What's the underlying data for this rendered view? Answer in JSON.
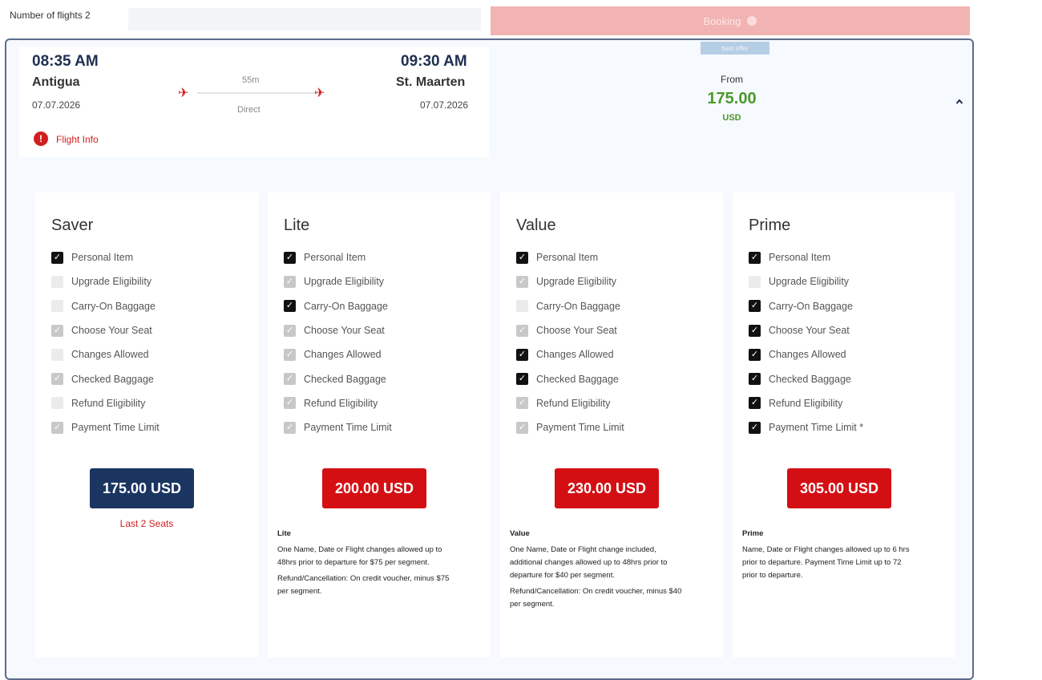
{
  "header": {
    "flights_count": "Number of flights 2",
    "faded_button": "Booking"
  },
  "flight": {
    "badge": "best offer",
    "departure": {
      "time": "08:35 AM",
      "city": "Antigua",
      "date": "07.07.2026"
    },
    "arrival": {
      "time": "09:30 AM",
      "city": "St. Maarten",
      "date": "07.07.2026"
    },
    "duration": "55m",
    "stops": "Direct",
    "info_link": "Flight Info",
    "from_label": "From",
    "from_price": "175.00",
    "from_currency": "USD"
  },
  "fares": [
    {
      "name": "Saver",
      "price": "175.00 USD",
      "button_color": "#1b3561",
      "last_seats": "Last 2 Seats",
      "desc_title": "",
      "desc_lines": [],
      "features": [
        {
          "label": "Personal Item",
          "state": "on"
        },
        {
          "label": "Upgrade Eligibility",
          "state": "off"
        },
        {
          "label": "Carry-On Baggage",
          "state": "off"
        },
        {
          "label": "Choose Your Seat",
          "state": "dim"
        },
        {
          "label": "Changes Allowed",
          "state": "off"
        },
        {
          "label": "Checked Baggage",
          "state": "dim"
        },
        {
          "label": "Refund Eligibility",
          "state": "off"
        },
        {
          "label": "Payment Time Limit",
          "state": "dim"
        }
      ]
    },
    {
      "name": "Lite",
      "price": "200.00 USD",
      "button_color": "#d40f14",
      "last_seats": "",
      "desc_title": "Lite",
      "desc_lines": [
        "One Name, Date or Flight changes allowed up to 48hrs prior to departure for $75 per segment.",
        "Refund/Cancellation: On credit voucher, minus $75 per segment."
      ],
      "features": [
        {
          "label": "Personal Item",
          "state": "on"
        },
        {
          "label": "Upgrade Eligibility",
          "state": "dim"
        },
        {
          "label": "Carry-On Baggage",
          "state": "on"
        },
        {
          "label": "Choose Your Seat",
          "state": "dim"
        },
        {
          "label": "Changes Allowed",
          "state": "dim"
        },
        {
          "label": "Checked Baggage",
          "state": "dim"
        },
        {
          "label": "Refund Eligibility",
          "state": "dim"
        },
        {
          "label": "Payment Time Limit",
          "state": "dim"
        }
      ]
    },
    {
      "name": "Value",
      "price": "230.00 USD",
      "button_color": "#d40f14",
      "last_seats": "",
      "desc_title": "Value",
      "desc_lines": [
        "One Name, Date or Flight change included, additional changes allowed up to 48hrs prior to departure for $40 per segment.",
        "Refund/Cancellation: On credit voucher, minus $40 per segment."
      ],
      "features": [
        {
          "label": "Personal Item",
          "state": "on"
        },
        {
          "label": "Upgrade Eligibility",
          "state": "dim"
        },
        {
          "label": "Carry-On Baggage",
          "state": "off"
        },
        {
          "label": "Choose Your Seat",
          "state": "dim"
        },
        {
          "label": "Changes Allowed",
          "state": "on"
        },
        {
          "label": "Checked Baggage",
          "state": "on"
        },
        {
          "label": "Refund Eligibility",
          "state": "dim"
        },
        {
          "label": "Payment Time Limit",
          "state": "dim"
        }
      ]
    },
    {
      "name": "Prime",
      "price": "305.00 USD",
      "button_color": "#d40f14",
      "last_seats": "",
      "desc_title": "Prime",
      "desc_lines": [
        "Name, Date or Flight changes allowed up to 6 hrs prior to departure. Payment Time Limit up to 72 prior to departure."
      ],
      "features": [
        {
          "label": "Personal Item",
          "state": "on"
        },
        {
          "label": "Upgrade Eligibility",
          "state": "off"
        },
        {
          "label": "Carry-On Baggage",
          "state": "on"
        },
        {
          "label": "Choose Your Seat",
          "state": "on"
        },
        {
          "label": "Changes Allowed",
          "state": "on"
        },
        {
          "label": "Checked Baggage",
          "state": "on"
        },
        {
          "label": "Refund Eligibility",
          "state": "on"
        },
        {
          "label": "Payment Time Limit *",
          "state": "on"
        }
      ]
    }
  ]
}
